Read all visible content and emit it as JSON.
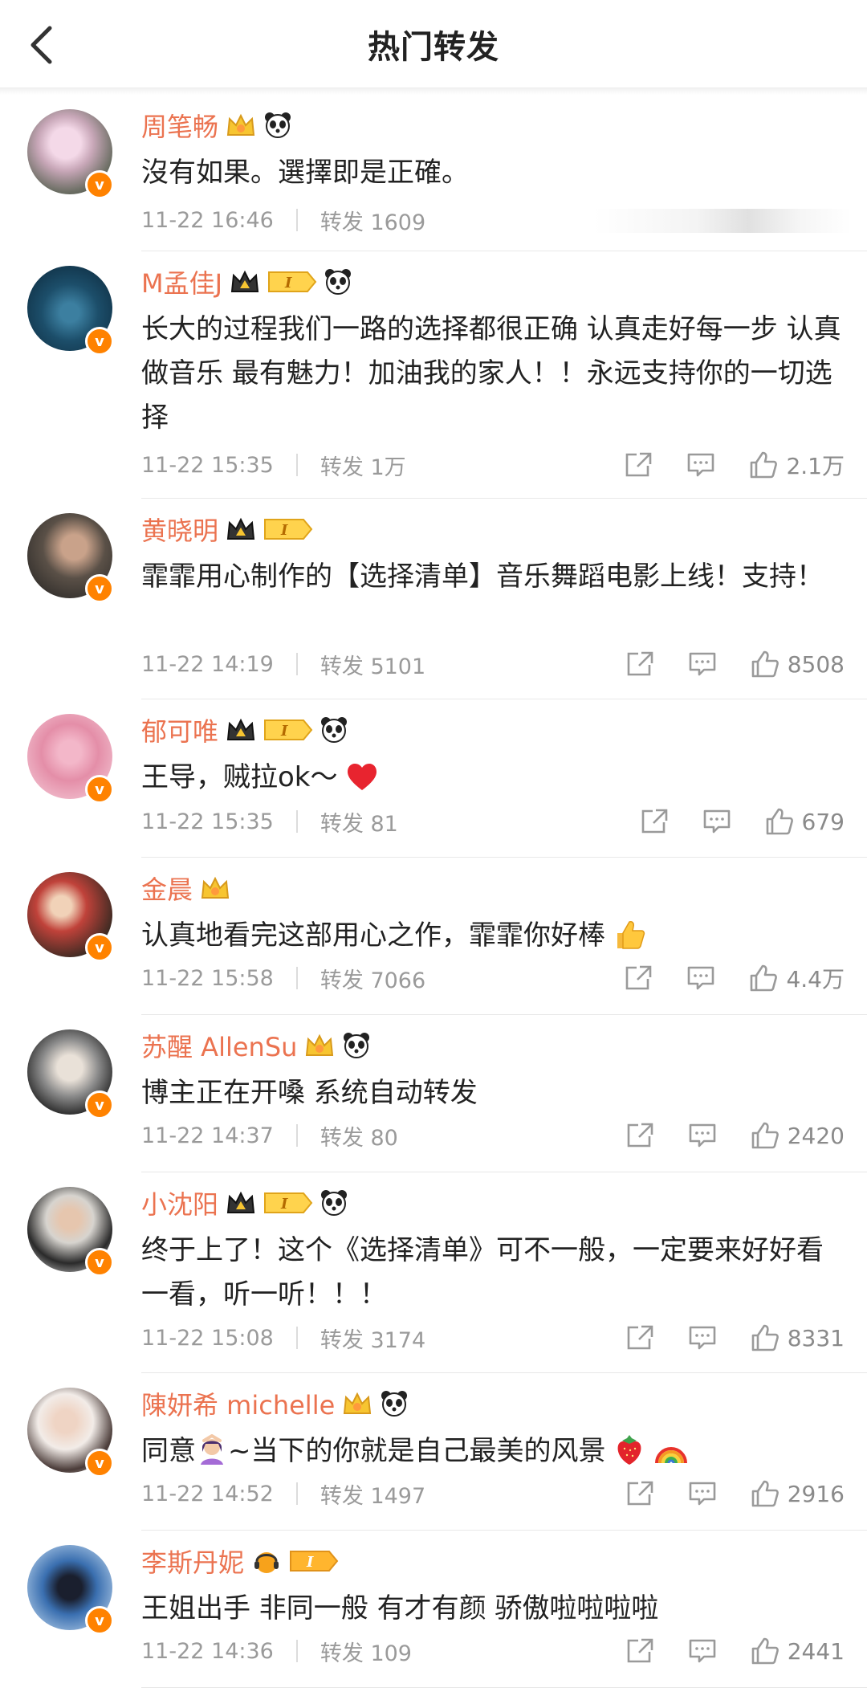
{
  "header": {
    "title": "热门转发"
  },
  "colors": {
    "name": "#eb7350",
    "badge": "#ff8200",
    "meta": "#9a9a9a"
  },
  "items": [
    {
      "name": "周笔畅",
      "text": "沒有如果。選擇即是正確。",
      "time": "11-22 16:46",
      "repost": "转发 1609",
      "likes": ""
    },
    {
      "name": "M孟佳J",
      "text": "长大的过程我们一路的选择都很正确 认真走好每一步 认真做音乐 最有魅力！加油我的家人！！永远支持你的一切选择",
      "time": "11-22 15:35",
      "repost": "转发 1万",
      "likes": "2.1万"
    },
    {
      "name": "黄晓明",
      "text": "霏霏用心制作的【选择清单】音乐舞蹈电影上线！支持！",
      "time": "11-22 14:19",
      "repost": "转发 5101",
      "likes": "8508"
    },
    {
      "name": "郁可唯",
      "text": "王导，贼拉ok～",
      "time": "11-22 15:35",
      "repost": "转发 81",
      "likes": "679"
    },
    {
      "name": "金晨",
      "text": "认真地看完这部用心之作，霏霏你好棒",
      "time": "11-22 15:58",
      "repost": "转发 7066",
      "likes": "4.4万"
    },
    {
      "name": "苏醒 AllenSu",
      "text": "博主正在开嗓 系统自动转发",
      "time": "11-22 14:37",
      "repost": "转发 80",
      "likes": "2420"
    },
    {
      "name": "小沈阳",
      "text": "终于上了！这个《选择清单》可不一般，一定要来好好看一看，听一听！！！",
      "time": "11-22 15:08",
      "repost": "转发 3174",
      "likes": "8331"
    },
    {
      "name": "陳妍希 michelle",
      "text_a": "同意",
      "text_b": "~当下的你就是自己最美的风景",
      "time": "11-22 14:52",
      "repost": "转发 1497",
      "likes": "2916"
    },
    {
      "name": "李斯丹妮",
      "text": "王姐出手 非同一般 有才有颜 骄傲啦啦啦啦",
      "time": "11-22 14:36",
      "repost": "转发 109",
      "likes": "2441"
    }
  ]
}
